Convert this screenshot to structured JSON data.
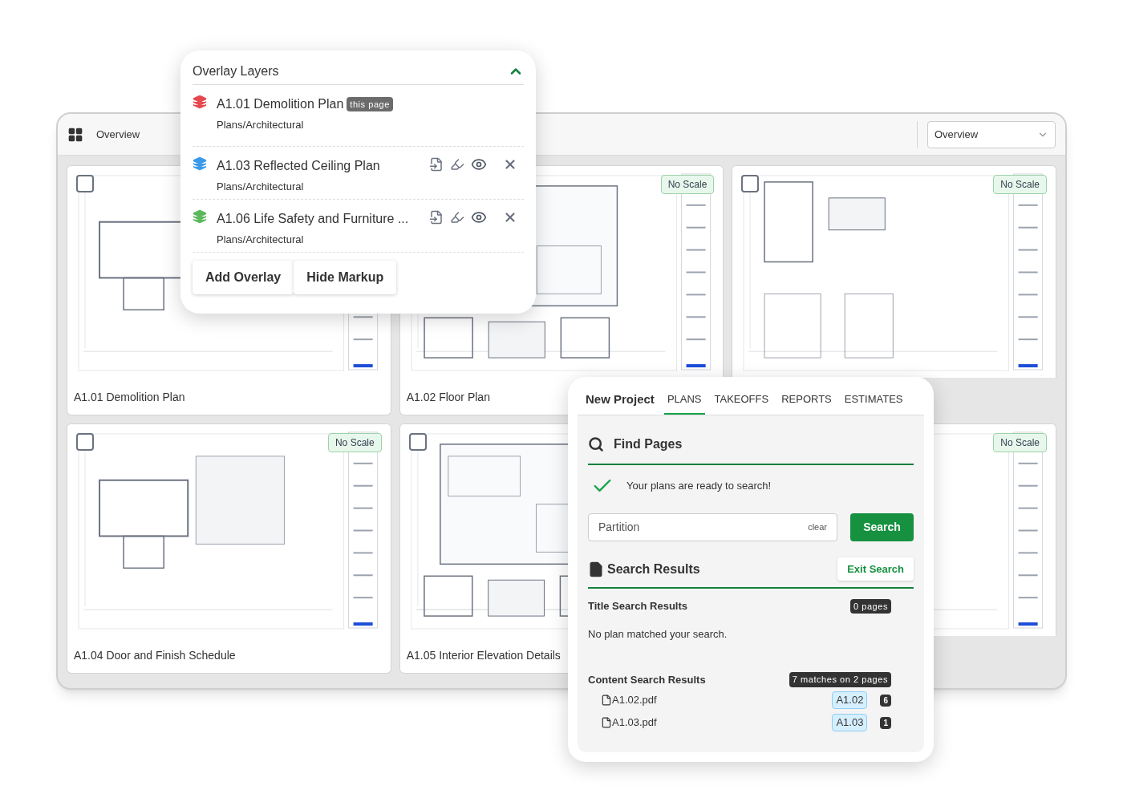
{
  "window": {
    "view_label": "Overview",
    "view_select": "Overview"
  },
  "sheets": [
    {
      "caption": "A1.01 Demolition Plan",
      "checked": false
    },
    {
      "caption": "A1.02 Floor Plan",
      "badge": "No Scale"
    },
    {
      "checked": false,
      "badge": "No Scale"
    },
    {
      "caption": "A1.04 Door and Finish Schedule",
      "checked": false,
      "badge": "No Scale"
    },
    {
      "caption": "A1.05 Interior Elevation Details",
      "checked": false
    },
    {
      "badge": "No Scale"
    }
  ],
  "overlay_panel": {
    "title": "Overlay Layers",
    "expanded": true,
    "layers": [
      {
        "kind": "current",
        "name": "A1.01 Demolition Plan",
        "badge": "this page",
        "path": "Plans/Architectural",
        "color": "#e5484d"
      },
      {
        "kind": "overlay",
        "name": "A1.03 Reflected Ceiling Plan",
        "path": "Plans/Architectural",
        "color": "#3b9ae8"
      },
      {
        "kind": "overlay",
        "name": "A1.06 Life Safety and Furniture ...",
        "path": "Plans/Architectural",
        "color": "#5cb85c"
      }
    ],
    "buttons": [
      "Add Overlay",
      "Hide Markup"
    ]
  },
  "search_panel": {
    "project": "New Project",
    "tabs": [
      {
        "label": "PLANS",
        "selected": true
      },
      {
        "label": "TAKEOFFS",
        "selected": false
      },
      {
        "label": "REPORTS",
        "selected": false
      },
      {
        "label": "ESTIMATES",
        "selected": false
      }
    ],
    "heading": "Find Pages",
    "status": "Your plans are ready to search!",
    "query": "Partition",
    "clear": "clear",
    "search_button": "Search",
    "results_heading": "Search Results",
    "exit_button": "Exit Search",
    "title_results": {
      "label": "Title Search Results",
      "count": "0 pages",
      "message": "No plan matched your search."
    },
    "content_results": {
      "label": "Content Search Results",
      "count": "7 matches on 2 pages",
      "files": [
        {
          "name": "A1.02.pdf",
          "page": "A1.02",
          "count": "6"
        },
        {
          "name": "A1.03.pdf",
          "page": "A1.03",
          "count": "1"
        }
      ]
    }
  }
}
